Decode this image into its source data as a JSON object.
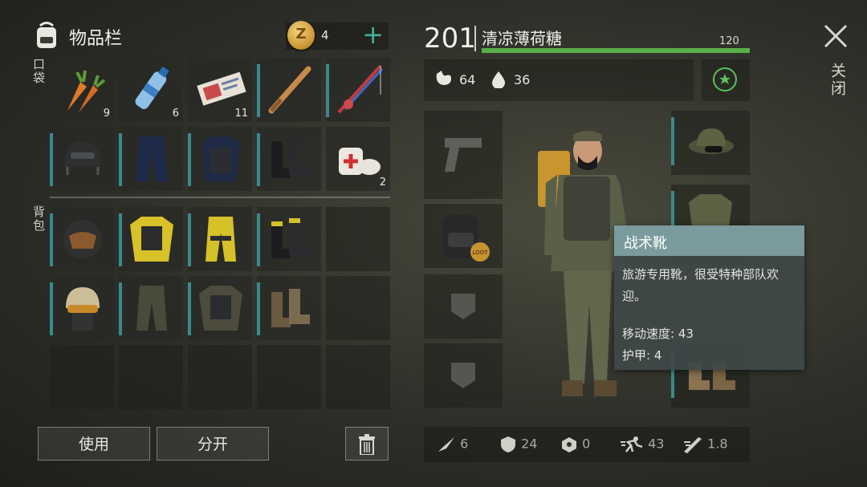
{
  "header": {
    "title": "物品栏",
    "coin_count": "4",
    "plus": "+"
  },
  "labels": {
    "pockets": "口袋",
    "backpack": "背包"
  },
  "inventory_quantities": {
    "carrot": "9",
    "water": "6",
    "ticket": "11",
    "medkit": "2"
  },
  "buttons": {
    "use": "使用",
    "split": "分开"
  },
  "character": {
    "level": "201",
    "name": "清凉薄荷糖",
    "hp_max": "120",
    "food": "64",
    "water": "36"
  },
  "equipment": {
    "backpack_badge": "LOOT"
  },
  "bottom_stats": {
    "attack": "6",
    "defense": "24",
    "radiation": "0",
    "speed": "43",
    "melee": "1.8"
  },
  "tooltip": {
    "title": "战术靴",
    "description": "旅游专用靴，很受特种部队欢迎。",
    "move_speed": "移动速度: 43",
    "armor": "护甲: 4"
  },
  "close_label": "关闭",
  "colors": {
    "accent_teal": "#3db39a",
    "hp_green": "#59b04a",
    "slot_bar": "#3a8a8c",
    "tooltip_header": "#7a9a9e"
  }
}
